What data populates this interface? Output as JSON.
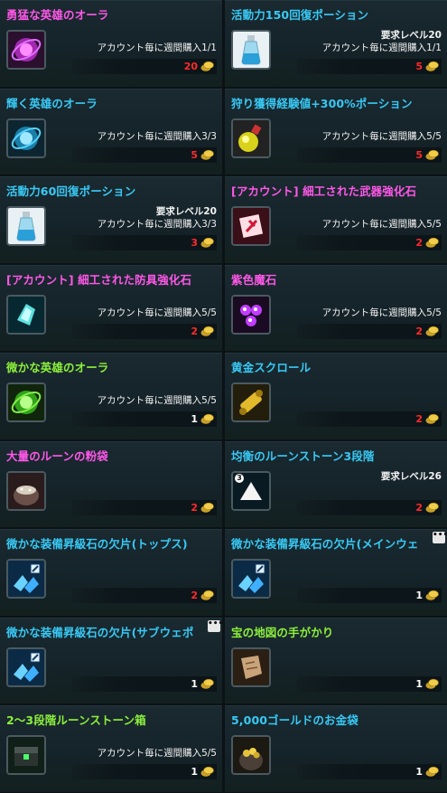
{
  "items": [
    {
      "name": "勇猛な英雄のオーラ",
      "color": "pink",
      "icon": "aura-magenta-icon",
      "req": "",
      "limit": "アカウント毎に週間購入1/1",
      "price": "20",
      "price_color": "red",
      "more": false
    },
    {
      "name": "活動力150回復ポーション",
      "color": "cyan",
      "icon": "potion-icon",
      "req": "要求レベル20",
      "limit": "アカウント毎に週間購入1/1",
      "price": "5",
      "price_color": "red",
      "more": false
    },
    {
      "name": "輝く英雄のオーラ",
      "color": "cyan",
      "icon": "aura-cyan-icon",
      "req": "",
      "limit": "アカウント毎に週間購入3/3",
      "price": "5",
      "price_color": "red",
      "more": false
    },
    {
      "name": "狩り獲得経験値+300%ポーション",
      "color": "cyan",
      "icon": "exp-potion-icon",
      "req": "",
      "limit": "アカウント毎に週間購入5/5",
      "price": "5",
      "price_color": "red",
      "more": false
    },
    {
      "name": "活動力60回復ポーション",
      "color": "cyan",
      "icon": "potion-icon",
      "req": "要求レベル20",
      "limit": "アカウント毎に週間購入3/3",
      "price": "3",
      "price_color": "red",
      "more": false
    },
    {
      "name": "[アカウント] 細工された武器強化石",
      "color": "pink",
      "icon": "weapon-stone-icon",
      "req": "",
      "limit": "アカウント毎に週間購入5/5",
      "price": "2",
      "price_color": "red",
      "more": false
    },
    {
      "name": "[アカウント] 細工された防具強化石",
      "color": "pink",
      "icon": "armor-stone-icon",
      "req": "",
      "limit": "アカウント毎に週間購入5/5",
      "price": "2",
      "price_color": "red",
      "more": false
    },
    {
      "name": "紫色魔石",
      "color": "pink",
      "icon": "purple-gem-icon",
      "req": "",
      "limit": "アカウント毎に週間購入5/5",
      "price": "2",
      "price_color": "red",
      "more": false
    },
    {
      "name": "微かな英雄のオーラ",
      "color": "green",
      "icon": "aura-green-icon",
      "req": "",
      "limit": "アカウント毎に週間購入5/5",
      "price": "1",
      "price_color": "white",
      "more": false
    },
    {
      "name": "黄金スクロール",
      "color": "cyan",
      "icon": "gold-scroll-icon",
      "req": "",
      "limit": "",
      "price": "2",
      "price_color": "red",
      "more": false
    },
    {
      "name": "大量のルーンの粉袋",
      "color": "pink",
      "icon": "rune-powder-bag-icon",
      "req": "",
      "limit": "",
      "price": "2",
      "price_color": "red",
      "more": false
    },
    {
      "name": "均衡のルーンストーン3段階",
      "color": "cyan",
      "icon": "runestone-icon",
      "req": "要求レベル26",
      "limit": "",
      "price": "2",
      "price_color": "red",
      "more": false,
      "badge": "3"
    },
    {
      "name": "微かな装備昇級石の欠片(トップス)",
      "color": "cyan",
      "icon": "upgrade-shard-icon",
      "req": "",
      "limit": "",
      "price": "2",
      "price_color": "red",
      "more": false
    },
    {
      "name": "微かな装備昇級石の欠片(メインウェ",
      "color": "cyan",
      "icon": "upgrade-shard-icon",
      "req": "",
      "limit": "",
      "price": "1",
      "price_color": "white",
      "more": true
    },
    {
      "name": "微かな装備昇級石の欠片(サブウェポ",
      "color": "cyan",
      "icon": "upgrade-shard-icon",
      "req": "",
      "limit": "",
      "price": "1",
      "price_color": "white",
      "more": true
    },
    {
      "name": "宝の地図の手がかり",
      "color": "green",
      "icon": "treasure-map-icon",
      "req": "",
      "limit": "",
      "price": "1",
      "price_color": "white",
      "more": false
    },
    {
      "name": "2～3段階ルーンストーン箱",
      "color": "green",
      "icon": "runestone-box-icon",
      "req": "",
      "limit": "アカウント毎に週間購入5/5",
      "price": "1",
      "price_color": "white",
      "more": false
    },
    {
      "name": "5,000ゴールドのお金袋",
      "color": "cyan",
      "icon": "gold-pouch-icon",
      "req": "",
      "limit": "",
      "price": "1",
      "price_color": "white",
      "more": false
    }
  ],
  "currency_icon": "gold-coin-icon",
  "more_label": "•••"
}
